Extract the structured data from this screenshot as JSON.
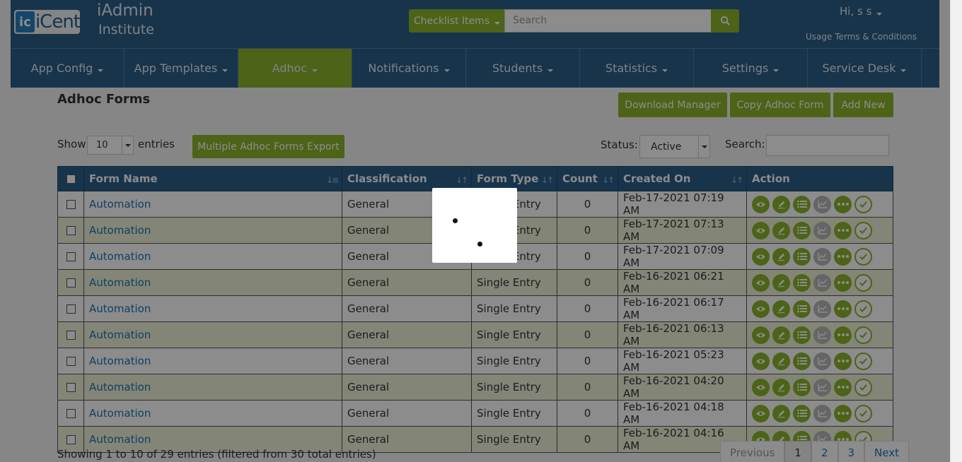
{
  "header": {
    "logo_text": "iCent",
    "brand_line1": "iAdmin",
    "brand_line2": "Institute",
    "checklist_label": "Checklist Items",
    "search_placeholder": "Search",
    "user_greeting": "Hi, s s",
    "usage_terms": "Usage Terms & Conditions"
  },
  "nav": {
    "items": [
      {
        "label": "App Config"
      },
      {
        "label": "App Templates"
      },
      {
        "label": "Adhoc",
        "active": true
      },
      {
        "label": "Notifications"
      },
      {
        "label": "Students"
      },
      {
        "label": "Statistics"
      },
      {
        "label": "Settings"
      },
      {
        "label": "Service Desk"
      }
    ]
  },
  "page": {
    "title": "Adhoc Forms",
    "download_manager": "Download Manager",
    "copy_form": "Copy Adhoc Form",
    "add_new": "Add New",
    "show_label": "Show",
    "page_size": "10",
    "entries_label": "entries",
    "export_label": "Multiple Adhoc Forms Export",
    "status_label": "Status:",
    "status_value": "Active",
    "search_label": "Search:"
  },
  "table": {
    "columns": [
      "Form Name",
      "Classification",
      "Form Type",
      "Count",
      "Created On",
      "Action"
    ],
    "rows": [
      {
        "name": "Automation",
        "classification": "General",
        "type": "Single Entry",
        "count": "0",
        "created": "Feb-17-2021 07:19 AM"
      },
      {
        "name": "Automation",
        "classification": "General",
        "type": "Single Entry",
        "count": "0",
        "created": "Feb-17-2021 07:13 AM"
      },
      {
        "name": "Automation",
        "classification": "General",
        "type": "Single Entry",
        "count": "0",
        "created": "Feb-17-2021 07:09 AM"
      },
      {
        "name": "Automation",
        "classification": "General",
        "type": "Single Entry",
        "count": "0",
        "created": "Feb-16-2021 06:21 AM"
      },
      {
        "name": "Automation",
        "classification": "General",
        "type": "Single Entry",
        "count": "0",
        "created": "Feb-16-2021 06:17 AM"
      },
      {
        "name": "Automation",
        "classification": "General",
        "type": "Single Entry",
        "count": "0",
        "created": "Feb-16-2021 06:13 AM"
      },
      {
        "name": "Automation",
        "classification": "General",
        "type": "Single Entry",
        "count": "0",
        "created": "Feb-16-2021 05:23 AM"
      },
      {
        "name": "Automation",
        "classification": "General",
        "type": "Single Entry",
        "count": "0",
        "created": "Feb-16-2021 04:20 AM"
      },
      {
        "name": "Automation",
        "classification": "General",
        "type": "Single Entry",
        "count": "0",
        "created": "Feb-16-2021 04:18 AM"
      },
      {
        "name": "Automation",
        "classification": "General",
        "type": "Single Entry",
        "count": "0",
        "created": "Feb-16-2021 04:16 AM"
      }
    ],
    "action_icons": [
      "view-icon",
      "edit-icon",
      "list-icon",
      "chart-icon",
      "more-icon",
      "approve-icon"
    ]
  },
  "footer": {
    "showing": "Showing 1 to 10 of 29 entries (filtered from 30 total entries)",
    "previous": "Previous",
    "pages": [
      "1",
      "2",
      "3"
    ],
    "next": "Next"
  },
  "colors": {
    "primary": "#2a5f89",
    "accent": "#8cb52a",
    "link": "#1f73b7"
  }
}
